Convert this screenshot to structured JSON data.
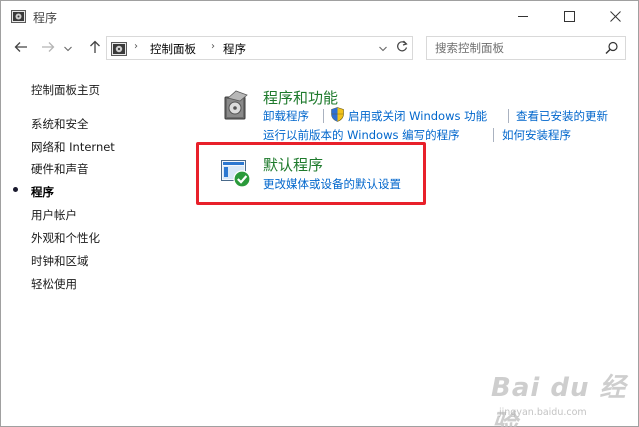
{
  "window": {
    "title": "程序",
    "controls": {
      "minimize": "minimize-icon",
      "maximize": "maximize-icon",
      "close": "close-icon"
    }
  },
  "nav": {
    "back": "arrow-left-icon",
    "forward": "arrow-right-icon",
    "recent": "chevron-down-icon",
    "up": "arrow-up-icon",
    "breadcrumb": [
      "控制面板",
      "程序"
    ],
    "refresh": "refresh-icon"
  },
  "search": {
    "placeholder": "搜索控制面板"
  },
  "sidebar": {
    "items": [
      {
        "label": "控制面板主页",
        "active": false
      },
      {
        "label": "系统和安全",
        "active": false
      },
      {
        "label": "网络和 Internet",
        "active": false
      },
      {
        "label": "硬件和声音",
        "active": false
      },
      {
        "label": "程序",
        "active": true
      },
      {
        "label": "用户帐户",
        "active": false
      },
      {
        "label": "外观和个性化",
        "active": false
      },
      {
        "label": "时钟和区域",
        "active": false
      },
      {
        "label": "轻松使用",
        "active": false
      }
    ]
  },
  "main": {
    "programs_features": {
      "title": "程序和功能",
      "links": [
        "卸载程序",
        "启用或关闭 Windows 功能",
        "查看已安装的更新",
        "运行以前版本的 Windows 编写的程序",
        "如何安装程序"
      ]
    },
    "default_programs": {
      "title": "默认程序",
      "links": [
        "更改媒体或设备的默认设置"
      ]
    }
  },
  "watermark": {
    "brand": "Bai du 经验",
    "url": "jingyan.baidu.com"
  },
  "colors": {
    "title_green": "#1e7a2c",
    "link_blue": "#0066cc",
    "highlight_red": "#e8202a"
  }
}
